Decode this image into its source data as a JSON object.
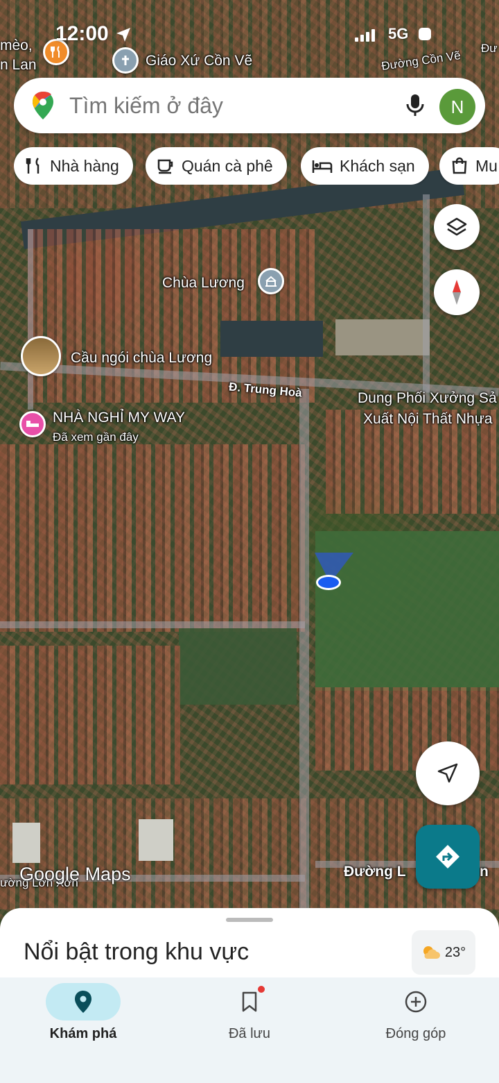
{
  "status_bar": {
    "time": "12:00",
    "network": "5G"
  },
  "search": {
    "placeholder": "Tìm kiếm ở đây",
    "avatar_letter": "N"
  },
  "chips": [
    {
      "label": "Nhà hàng",
      "icon": "utensils-icon"
    },
    {
      "label": "Quán cà phê",
      "icon": "coffee-icon"
    },
    {
      "label": "Khách sạn",
      "icon": "bed-icon"
    },
    {
      "label": "Mu",
      "icon": "shopping-bag-icon"
    }
  ],
  "map_labels": {
    "top_left_1": "mèo,",
    "top_left_2": "n Lan",
    "church": "Giáo Xứ Cồn Vẽ",
    "road_top": "Đường Cồn Vẽ",
    "road_top_right": "Đư",
    "pagoda": "Chùa Lương",
    "bridge": "Cầu ngói chùa Lương",
    "street": "Đ. Trung Hoà",
    "business_1": "Dung Phối Xưởng Sả",
    "business_2": "Xuất Nội Thất Nhựa",
    "guesthouse": "NHÀ NGHỈ MY WAY",
    "guesthouse_note": "Đã xem gần đây",
    "road_bottom": "Đường L",
    "road_bottom_end": "n",
    "road_bottom_left": "ường Lơn Xơn"
  },
  "watermark": "Google Maps",
  "bottom_sheet": {
    "title": "Nổi bật trong khu vực",
    "weather": "23°"
  },
  "bottom_nav": [
    {
      "label": "Khám phá",
      "icon": "location-pin-icon",
      "active": true
    },
    {
      "label": "Đã lưu",
      "icon": "bookmark-icon",
      "active": false
    },
    {
      "label": "Đóng góp",
      "icon": "add-circle-icon",
      "active": false
    }
  ],
  "colors": {
    "accent": "#0b7a8a",
    "active_nav": "#c3eaf3",
    "avatar": "#5a9a3a"
  }
}
